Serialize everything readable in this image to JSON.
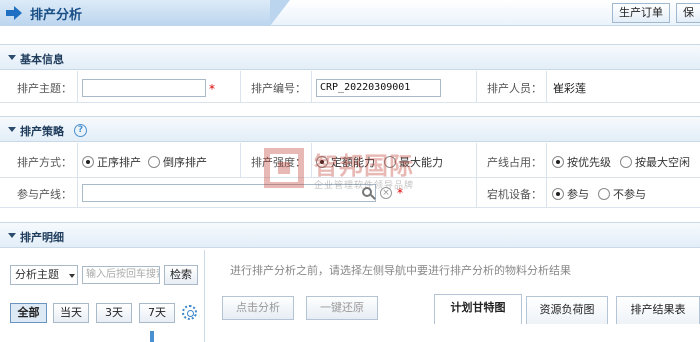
{
  "header": {
    "title": "排产分析",
    "buttons": [
      "生产订单",
      "保存"
    ]
  },
  "basic_info": {
    "section_title": "基本信息",
    "theme_label": "排产主题：",
    "theme_value": "",
    "code_label": "排产编号：",
    "code_value": "CRP_20220309001",
    "person_label": "排产人员：",
    "person_value": "崔彩莲",
    "required_mark": "*"
  },
  "strategy": {
    "section_title": "排产策略",
    "help": "?",
    "mode_label": "排产方式：",
    "mode_options": [
      {
        "label": "正序排产",
        "selected": true
      },
      {
        "label": "倒序排产",
        "selected": false
      }
    ],
    "intensity_label": "排产强度：",
    "intensity_options": [
      {
        "label": "定额能力",
        "selected": true
      },
      {
        "label": "最大能力",
        "selected": false
      }
    ],
    "line_usage_label": "产线占用：",
    "line_usage_options": [
      {
        "label": "按优先级",
        "selected": true
      },
      {
        "label": "按最大空闲",
        "selected": false
      }
    ],
    "lines_label": "参与产线：",
    "lines_value": "",
    "downtime_label": "宕机设备：",
    "downtime_options": [
      {
        "label": "参与",
        "selected": true
      },
      {
        "label": "不参与",
        "selected": false
      }
    ],
    "required_mark": "*"
  },
  "detail": {
    "section_title": "排产明细",
    "filter_select": "分析主题",
    "search_placeholder": "输入后按回车搜索",
    "search_button": "检索",
    "range_buttons": [
      "全部",
      "当天",
      "3天",
      "7天"
    ],
    "hint": "进行排产分析之前，请选择左侧导航中要进行排产分析的物料分析结果",
    "analyze_button": "点击分析",
    "reset_button": "一键还原",
    "tabs": [
      "计划甘特图",
      "资源负荷图",
      "排产结果表"
    ]
  },
  "watermark": {
    "name": "智邦国际",
    "slogan": "企业管理软件领导品牌"
  },
  "colors": {
    "accent": "#1a4f86",
    "required": "#dd0000",
    "section_bg": "#e3eef8"
  }
}
